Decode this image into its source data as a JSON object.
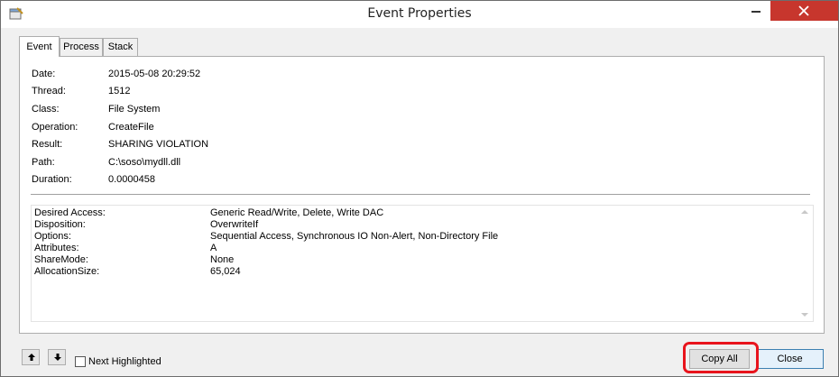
{
  "window": {
    "title": "Event Properties"
  },
  "tabs": [
    {
      "label": "Event",
      "active": true
    },
    {
      "label": "Process",
      "active": false
    },
    {
      "label": "Stack",
      "active": false
    }
  ],
  "event": {
    "fields": [
      {
        "label": "Date:",
        "value": "2015-05-08 20:29:52"
      },
      {
        "label": "Thread:",
        "value": "1512"
      },
      {
        "label": "Class:",
        "value": "File System"
      },
      {
        "label": "Operation:",
        "value": "CreateFile"
      },
      {
        "label": "Result:",
        "value": "SHARING VIOLATION"
      },
      {
        "label": "Path:",
        "value": "C:\\soso\\mydll.dll"
      },
      {
        "label": "Duration:",
        "value": "0.0000458"
      }
    ],
    "details": [
      {
        "label": "Desired Access:",
        "value": "Generic Read/Write, Delete, Write DAC"
      },
      {
        "label": "Disposition:",
        "value": "OverwriteIf"
      },
      {
        "label": "Options:",
        "value": "Sequential Access, Synchronous IO Non-Alert, Non-Directory File"
      },
      {
        "label": "Attributes:",
        "value": "A"
      },
      {
        "label": "ShareMode:",
        "value": "None"
      },
      {
        "label": "AllocationSize:",
        "value": "65,024"
      }
    ]
  },
  "footer": {
    "next_highlighted_label": "Next Highlighted",
    "next_highlighted_checked": false,
    "copy_all_label": "Copy All",
    "close_label": "Close"
  },
  "colors": {
    "close_button_bg": "#c7362d",
    "annotation_outline": "#e8141c",
    "default_button_border": "#3c7fb1"
  },
  "icons": {
    "app": "event-properties-app-icon",
    "up": "arrow-up-icon",
    "down": "arrow-down-icon",
    "close": "close-icon"
  }
}
